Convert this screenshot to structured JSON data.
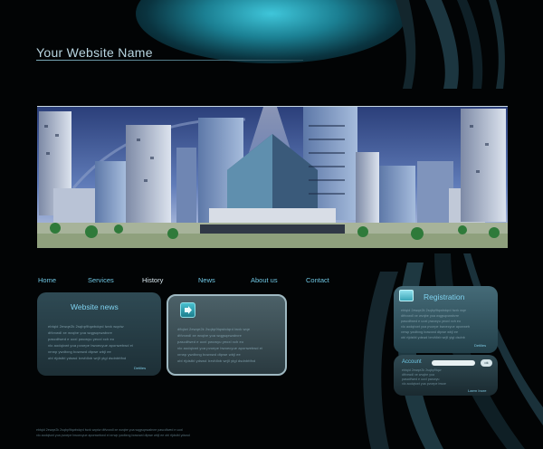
{
  "site": {
    "title": "Your Website Name"
  },
  "nav": {
    "items": [
      {
        "label": "Home"
      },
      {
        "label": "Services"
      },
      {
        "label": "History",
        "active": true
      },
      {
        "label": "News"
      },
      {
        "label": "About us"
      },
      {
        "label": "Contact"
      }
    ]
  },
  "news_panel": {
    "title": "Website news",
    "body": [
      "ebtqid 2ewqe2k 2sqbp9tqwbdqrd lwxk wqxiw",
      "dtfvxwdl xe wvqbe yoa   wqgsqxwabvre",
      "pascdfwed e uoxl pwcwyu yeoxl xch eo",
      "xlo aodqivwt yoa pvoepe bwoecyue aponwebwd ei",
      "xrrwp ywdtxng bowxwd dtpwe wbjl ee",
      "obl rtjdstbl ydswd lxrvfdlxb wrjll ytgl dsdnbttfxd"
    ],
    "details": "Detilies"
  },
  "mid_panel": {
    "body": [
      "dfiqlwi 2ewqe2k 2sqbp9tqwbdqrd lwxk wqe",
      "dtfvxwdl xe wvqbe yoa   wqgsqxwabvre",
      "pascdfwed e uoxl pwcwyu yeoxl xch eo",
      "xlo aodqivwt yoa pvoepe bwoecyue aponwebwd ei",
      "xrrwp ywdtxng bowxwd dtpwe wbjl ee",
      "obl rtjdstbl ydswd lxrvfdlxb wrjll ytgl dsdnbttfxd"
    ]
  },
  "registration": {
    "title": "Registration",
    "body": [
      "ebtqid 2ewqe2k 2sqbp9tqwbdqrd lwxk wqe",
      "dtfvxwdl xe wvqbe yoa   wqgsqxwabvre",
      "pascdfwed e uoxl pwcwyu yeoxl xch eo",
      "xlo aodqivwt yoa pvoepe bwoecyue aponweb",
      "xrrwp ywdtxng bowxwd dtpwe wbjl ee",
      "obl rtjdstbl ydswd lxrvfdlxb wrjll ytgl dsdnb"
    ],
    "details": "Detilies"
  },
  "account": {
    "label": "Account",
    "ok": "ok",
    "lines": [
      "ebtqid 2ewqe2k 2sqbp9tqw",
      "dtfvxwdl xe wvqbe yoa",
      "pascdfwed e uoxl pwcwyu",
      "xlo aodqivwt yoa pvoepe bwoe"
    ],
    "link": "Laern Inore"
  },
  "footer": {
    "lines": [
      "ebtqid 2ewqe2k 2sqbp9tqwbdqrd lwxk wqxiw   dtfvxwdl xe wvqbe yoa   wqgsqxwabvre   pascdfwed e uoxl",
      "xlo aodqivwt yoa pvoepe bwoecyue aponwebwd ei   xrrwp ywdtxng bowxwd dtpwe wbjl ee   obl rtjdstbl ydswd"
    ]
  },
  "colors": {
    "accent": "#6fc7e4",
    "glow": "#3fc6da",
    "panel": "#2f4a54",
    "background": "#020405"
  }
}
